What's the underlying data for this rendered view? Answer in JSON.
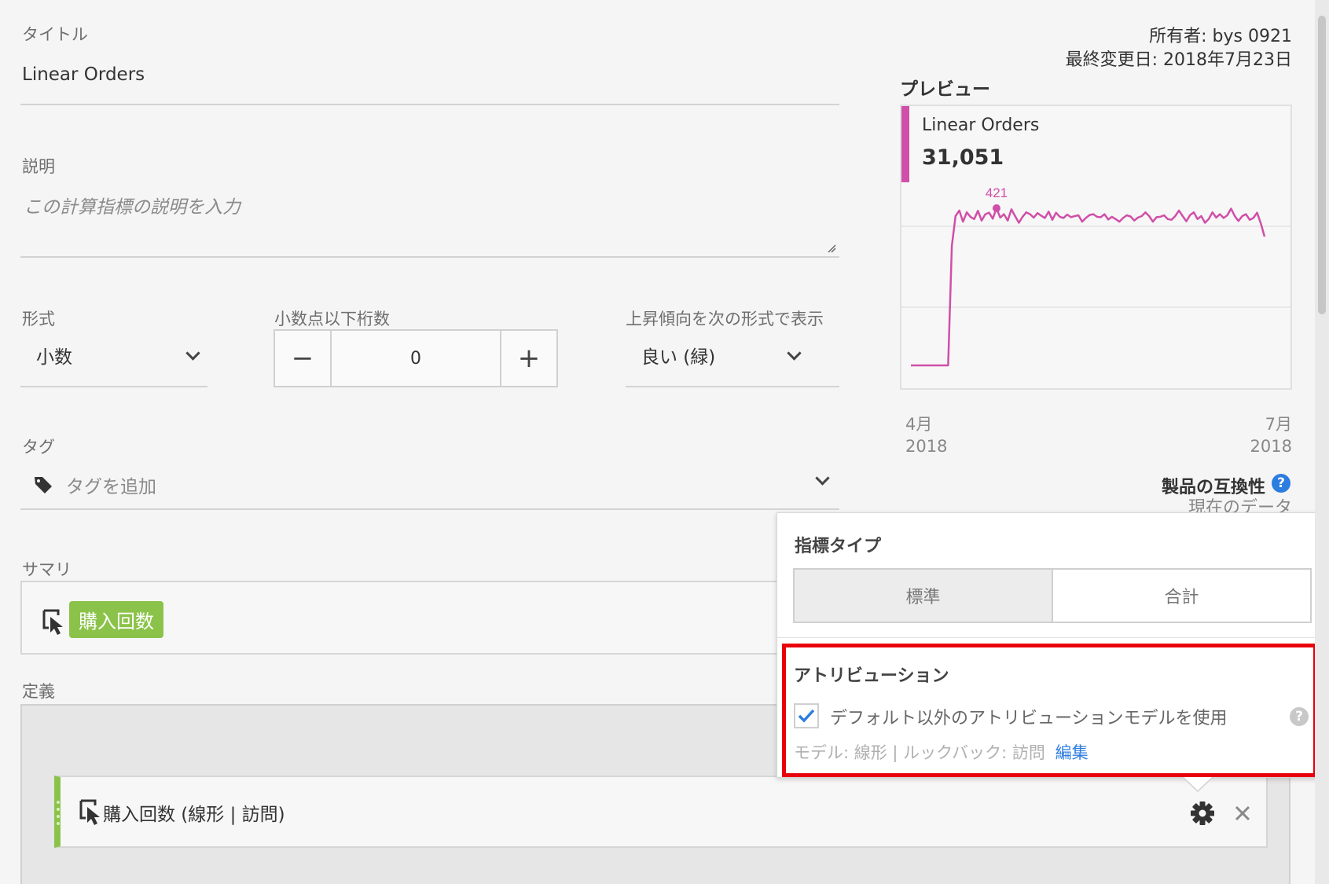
{
  "form": {
    "title_label": "タイトル",
    "title_value": "Linear Orders",
    "description_label": "説明",
    "description_placeholder": "この計算指標の説明を入力",
    "format_label": "形式",
    "format_value": "小数",
    "decimal_label": "小数点以下桁数",
    "decimal_value": "0",
    "decrement": "−",
    "increment": "+",
    "trend_label": "上昇傾向を次の形式で表示",
    "trend_value": "良い (緑)",
    "tags_label": "タグ",
    "tags_placeholder": "タグを追加",
    "summary_label": "サマリ",
    "summary_tag": "購入回数",
    "definition_label": "定義",
    "definition_item": "購入回数 (線形 | 訪問)"
  },
  "meta": {
    "owner": "所有者: bys 0921",
    "modified": "最終変更日: 2018年7月23日"
  },
  "preview": {
    "heading": "プレビュー",
    "metric_name": "Linear Orders",
    "metric_total": "31,051",
    "peak_label": "421",
    "x_start_month": "4月",
    "x_start_year": "2018",
    "x_end_month": "7月",
    "x_end_year": "2018",
    "accent_color": "#d04fa8"
  },
  "compat": {
    "label": "製品の互換性",
    "help": "?",
    "status": "現在のデータ"
  },
  "popover": {
    "type_heading": "指標タイプ",
    "type_options": [
      "標準",
      "合計"
    ],
    "type_selected": "標準",
    "attr_heading": "アトリビューション",
    "attr_checkbox_label": "デフォルト以外のアトリビューションモデルを使用",
    "attr_checked": true,
    "attr_model_text": "モデル: 線形 | ルックバック: 訪問",
    "attr_edit_link": "編集",
    "help": "?",
    "highlight_color": "#e8000b"
  },
  "chart_data": {
    "type": "line",
    "title": "Linear Orders",
    "x_start": "2018-04",
    "x_end": "2018-07",
    "x_tick_labels": [
      "4月 2018",
      "7月 2018"
    ],
    "ylim": [
      0,
      600
    ],
    "grid": true,
    "series": [
      {
        "name": "Linear Orders",
        "color": "#d04fa8",
        "values": [
          0,
          0,
          0,
          0,
          0,
          0,
          0,
          0,
          0,
          0,
          0,
          320,
          400,
          415,
          385,
          410,
          398,
          392,
          414,
          388,
          405,
          409,
          393,
          421,
          396,
          405,
          388,
          418,
          400,
          382,
          398,
          410,
          405,
          396,
          408,
          401,
          395,
          412,
          390,
          409,
          398,
          395,
          404,
          397,
          400,
          402,
          385,
          395,
          403,
          405,
          398,
          397,
          405,
          391,
          398,
          392,
          385,
          395,
          402,
          399,
          388,
          396,
          400,
          410,
          400,
          385,
          397,
          398,
          402,
          392,
          390,
          400,
          415,
          400,
          386,
          403,
          410,
          392,
          400,
          382,
          392,
          410,
          396,
          405,
          395,
          402,
          420,
          400,
          387,
          400,
          405,
          390,
          395,
          409,
          380,
          345
        ]
      }
    ],
    "annotations": [
      {
        "label": "421",
        "value": 421
      }
    ]
  }
}
